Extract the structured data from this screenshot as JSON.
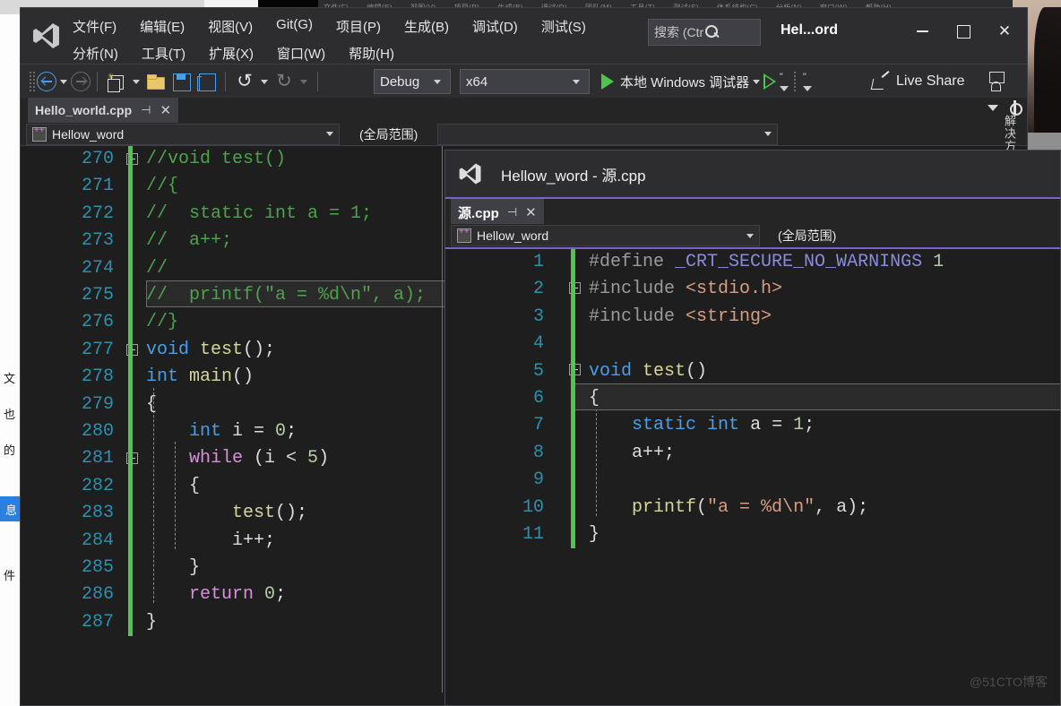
{
  "app": {
    "name": "Visual Studio",
    "logo_icon": "visual-studio-logo-icon",
    "window_title": "Hel...ord"
  },
  "menu": {
    "row1": [
      "文件(F)",
      "编辑(E)",
      "视图(V)",
      "Git(G)",
      "项目(P)",
      "生成(B)",
      "调试(D)",
      "测试(S)"
    ],
    "row2": [
      "分析(N)",
      "工具(T)",
      "扩展(X)",
      "窗口(W)",
      "帮助(H)"
    ]
  },
  "search": {
    "placeholder": "搜索 (Ctrl...",
    "icon": "search-icon"
  },
  "window_controls": {
    "minimize": "minimize-icon",
    "maximize": "maximize-icon",
    "close": "✕"
  },
  "toolbar": {
    "nav_back_icon": "navigate-back-icon",
    "nav_forward_icon": "navigate-forward-icon",
    "new_project_icon": "new-project-icon",
    "open_file_icon": "open-file-icon",
    "save_icon": "save-icon",
    "save_all_icon": "save-all-icon",
    "undo_icon": "undo-icon",
    "redo_icon": "redo-icon",
    "configuration": "Debug",
    "platform": "x64",
    "start_debug_label": "本地 Windows 调试器",
    "start_debug_icon": "play-icon",
    "attach_icon": "play-outline-icon",
    "step_icons": [
      "step-into-icon",
      "step-over-icon",
      "step-out-icon"
    ],
    "live_share_label": "Live Share",
    "live_share_icon": "share-icon",
    "feedback_icon": "send-feedback-icon"
  },
  "main_editor": {
    "tab": {
      "label": "Hello_world.cpp",
      "pin_icon": "pin-icon",
      "close_icon": "close-icon"
    },
    "tab_right": {
      "dropdown_icon": "chevron-down-icon",
      "gear_icon": "gear-icon"
    },
    "nav": {
      "project_icon": "cpp-file-icon",
      "project": "Hellow_word",
      "scope": "(全局范围)"
    },
    "lines": [
      {
        "n": "270",
        "segs": [
          {
            "t": "//void test()",
            "c": "cm"
          }
        ]
      },
      {
        "n": "271",
        "segs": [
          {
            "t": "//{",
            "c": "cm"
          }
        ]
      },
      {
        "n": "272",
        "segs": [
          {
            "t": "//  static int a = 1;",
            "c": "cm"
          }
        ]
      },
      {
        "n": "273",
        "segs": [
          {
            "t": "//  a++;",
            "c": "cm"
          }
        ]
      },
      {
        "n": "274",
        "segs": [
          {
            "t": "//",
            "c": "cm"
          }
        ]
      },
      {
        "n": "275",
        "segs": [
          {
            "t": "//  printf(\"a = %d\\n\", a);",
            "c": "cm"
          }
        ]
      },
      {
        "n": "276",
        "segs": [
          {
            "t": "//}",
            "c": "cm"
          }
        ]
      },
      {
        "n": "277",
        "segs": [
          {
            "t": "void",
            "c": "kw"
          },
          {
            "t": " ",
            "c": "pl"
          },
          {
            "t": "test",
            "c": "fn"
          },
          {
            "t": "();",
            "c": "pl"
          }
        ]
      },
      {
        "n": "278",
        "segs": [
          {
            "t": "int",
            "c": "kw"
          },
          {
            "t": " ",
            "c": "pl"
          },
          {
            "t": "main",
            "c": "fn"
          },
          {
            "t": "()",
            "c": "pl"
          }
        ]
      },
      {
        "n": "279",
        "segs": [
          {
            "t": "{",
            "c": "pl"
          }
        ]
      },
      {
        "n": "280",
        "segs": [
          {
            "t": "    ",
            "c": "pl"
          },
          {
            "t": "int",
            "c": "kw"
          },
          {
            "t": " i = ",
            "c": "pl"
          },
          {
            "t": "0",
            "c": "num"
          },
          {
            "t": ";",
            "c": "pl"
          }
        ]
      },
      {
        "n": "281",
        "segs": [
          {
            "t": "    ",
            "c": "pl"
          },
          {
            "t": "while",
            "c": "kw2"
          },
          {
            "t": " (i < ",
            "c": "pl"
          },
          {
            "t": "5",
            "c": "num"
          },
          {
            "t": ")",
            "c": "pl"
          }
        ]
      },
      {
        "n": "282",
        "segs": [
          {
            "t": "    {",
            "c": "pl"
          }
        ]
      },
      {
        "n": "283",
        "segs": [
          {
            "t": "        ",
            "c": "pl"
          },
          {
            "t": "test",
            "c": "fn"
          },
          {
            "t": "();",
            "c": "pl"
          }
        ]
      },
      {
        "n": "284",
        "segs": [
          {
            "t": "        i++;",
            "c": "pl"
          }
        ]
      },
      {
        "n": "285",
        "segs": [
          {
            "t": "    }",
            "c": "pl"
          }
        ]
      },
      {
        "n": "286",
        "segs": [
          {
            "t": "    ",
            "c": "pl"
          },
          {
            "t": "return",
            "c": "kw2"
          },
          {
            "t": " ",
            "c": "pl"
          },
          {
            "t": "0",
            "c": "num"
          },
          {
            "t": ";",
            "c": "pl"
          }
        ]
      },
      {
        "n": "287",
        "segs": [
          {
            "t": "}",
            "c": "pl"
          }
        ]
      }
    ]
  },
  "float_window": {
    "logo_icon": "visual-studio-logo-icon",
    "title": "Hellow_word - 源.cpp",
    "tab": {
      "label": "源.cpp",
      "pin_icon": "pin-icon",
      "close_icon": "close-icon"
    },
    "nav": {
      "project_icon": "cpp-file-icon",
      "project": "Hellow_word",
      "scope": "(全局范围)"
    },
    "lines": [
      {
        "n": "1",
        "segs": [
          {
            "t": "#define",
            "c": "pp"
          },
          {
            "t": " ",
            "c": "pl"
          },
          {
            "t": "_CRT_SECURE_NO_WARNINGS",
            "c": "mac"
          },
          {
            "t": " ",
            "c": "pl"
          },
          {
            "t": "1",
            "c": "num"
          }
        ]
      },
      {
        "n": "2",
        "segs": [
          {
            "t": "#include",
            "c": "pp"
          },
          {
            "t": " ",
            "c": "pl"
          },
          {
            "t": "<stdio.h>",
            "c": "hdr"
          }
        ]
      },
      {
        "n": "3",
        "segs": [
          {
            "t": "#include",
            "c": "pp"
          },
          {
            "t": " ",
            "c": "pl"
          },
          {
            "t": "<string>",
            "c": "hdr"
          }
        ]
      },
      {
        "n": "4",
        "segs": [
          {
            "t": "",
            "c": "pl"
          }
        ]
      },
      {
        "n": "5",
        "segs": [
          {
            "t": "void",
            "c": "kw"
          },
          {
            "t": " ",
            "c": "pl"
          },
          {
            "t": "test",
            "c": "fn"
          },
          {
            "t": "()",
            "c": "pl"
          }
        ]
      },
      {
        "n": "6",
        "segs": [
          {
            "t": "{",
            "c": "pl"
          }
        ]
      },
      {
        "n": "7",
        "segs": [
          {
            "t": "    ",
            "c": "pl"
          },
          {
            "t": "static",
            "c": "kw"
          },
          {
            "t": " ",
            "c": "pl"
          },
          {
            "t": "int",
            "c": "kw"
          },
          {
            "t": " a = ",
            "c": "pl"
          },
          {
            "t": "1",
            "c": "num"
          },
          {
            "t": ";",
            "c": "pl"
          }
        ]
      },
      {
        "n": "8",
        "segs": [
          {
            "t": "    a++;",
            "c": "pl"
          }
        ]
      },
      {
        "n": "9",
        "segs": [
          {
            "t": "",
            "c": "pl"
          }
        ]
      },
      {
        "n": "10",
        "segs": [
          {
            "t": "    ",
            "c": "pl"
          },
          {
            "t": "printf",
            "c": "fn"
          },
          {
            "t": "(",
            "c": "pl"
          },
          {
            "t": "\"a = %d\\n\"",
            "c": "str"
          },
          {
            "t": ", a);",
            "c": "pl"
          }
        ]
      },
      {
        "n": "11",
        "segs": [
          {
            "t": "}",
            "c": "pl"
          }
        ]
      }
    ]
  },
  "solution_explorer_tab": "解决方",
  "background_doc": {
    "chars": [
      "文",
      "也",
      "的",
      "息",
      "件"
    ]
  },
  "watermark": "@51CTO博客",
  "colors": {
    "editor_bg": "#1e1e1e",
    "chrome_bg": "#2d2d30",
    "accent_purple": "#7a5fd6",
    "line_number": "#2b91af",
    "comment_green": "#4ea24e",
    "keyword_blue": "#4a9ee8",
    "change_bar_green": "#51c351"
  }
}
